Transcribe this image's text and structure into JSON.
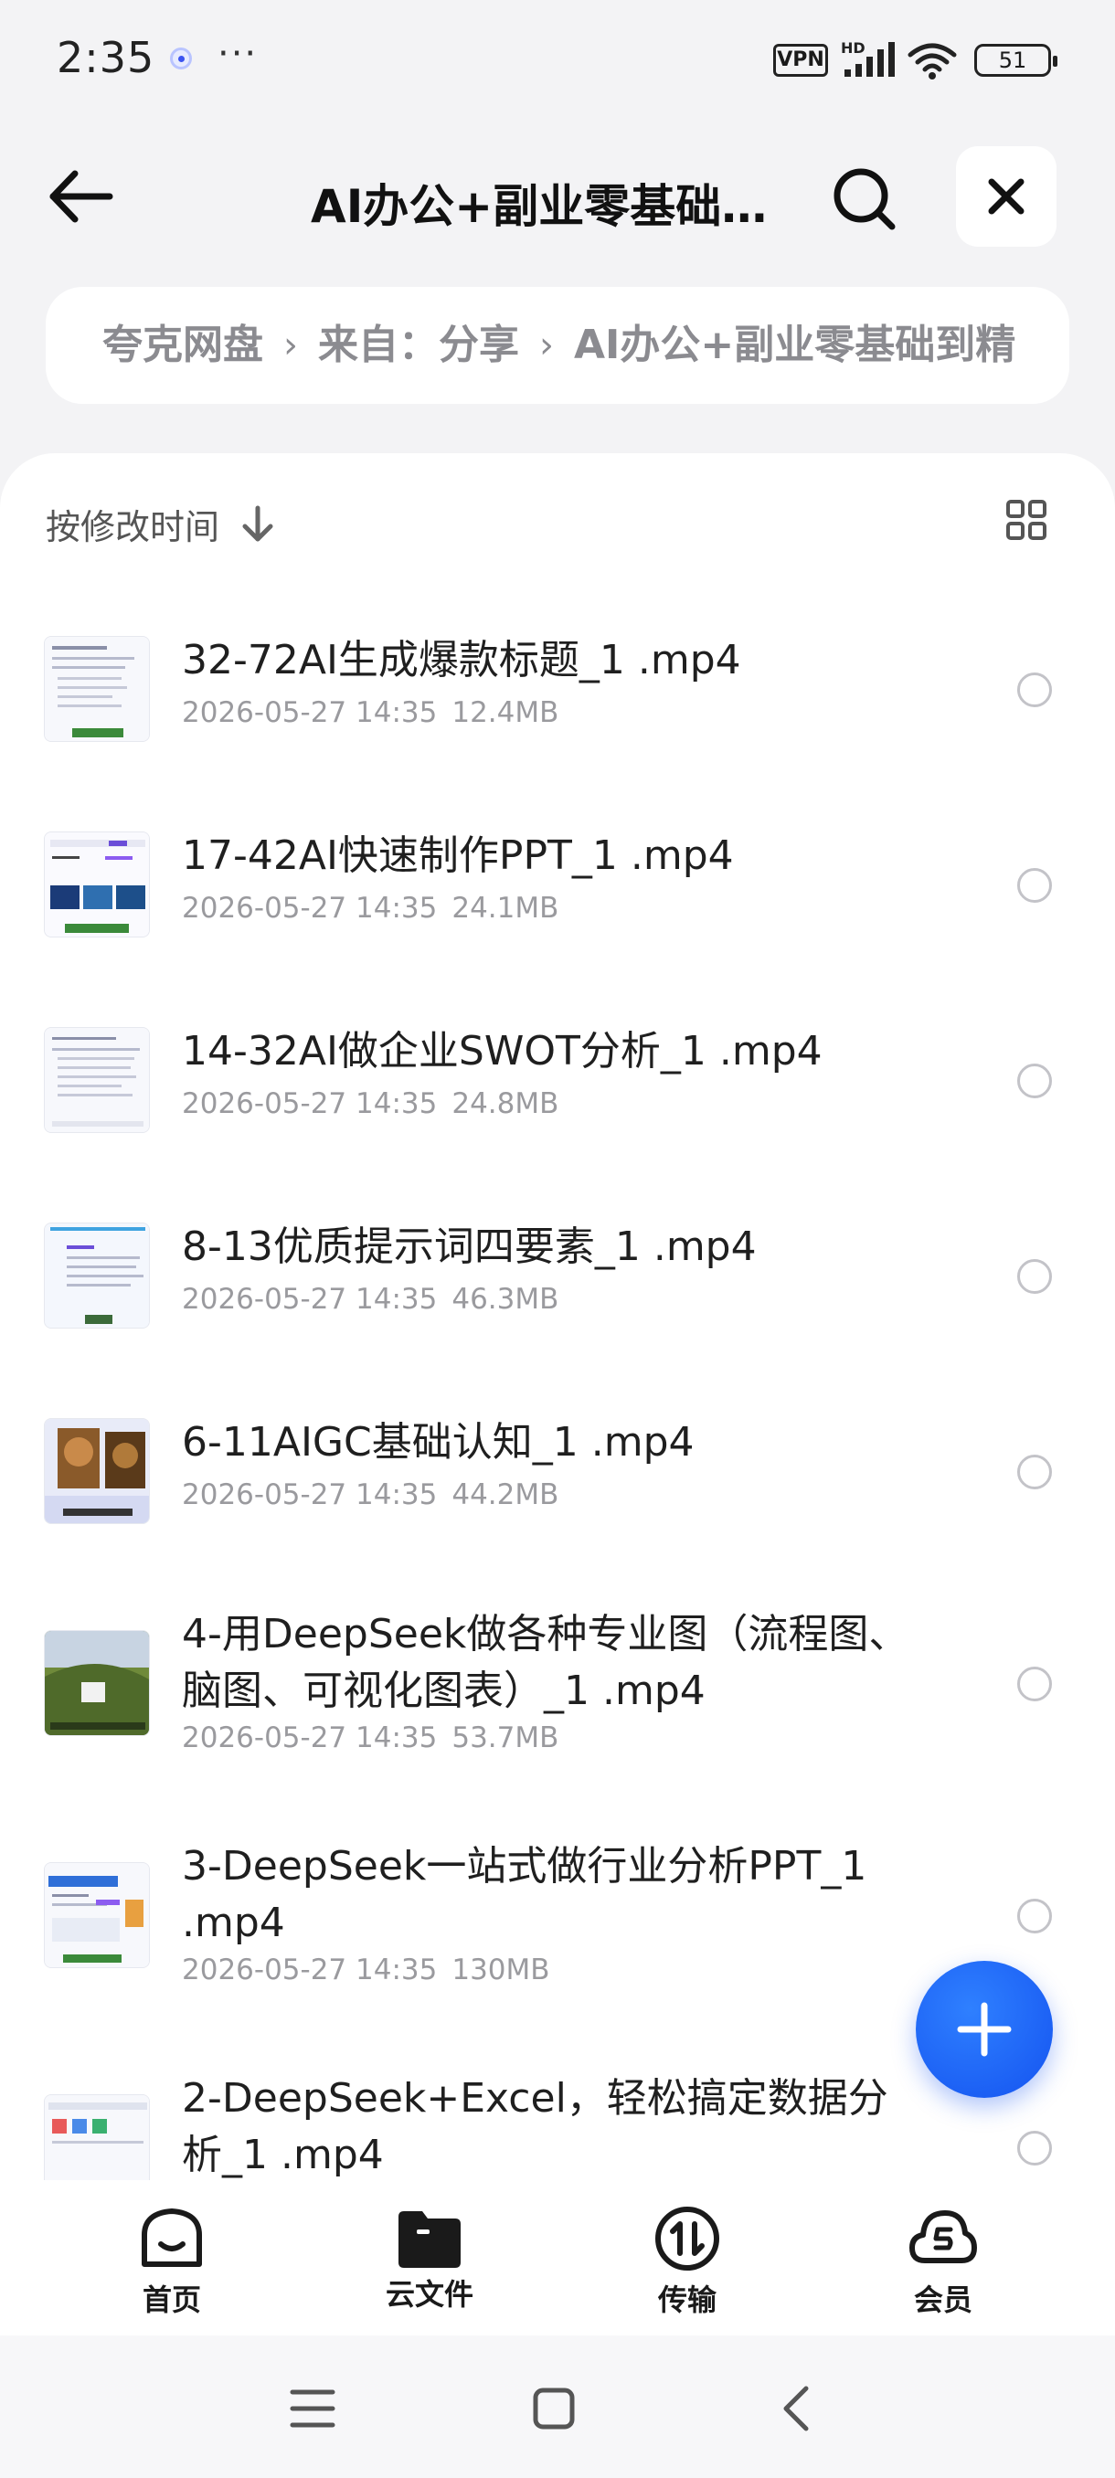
{
  "status_bar": {
    "time": "2:35",
    "more": "···",
    "vpn": "VPN",
    "battery": "51"
  },
  "header": {
    "title": "AI办公+副业零基础..."
  },
  "breadcrumb": [
    "夸克网盘",
    "来自：分享",
    "AI办公+副业零基础到精"
  ],
  "toolbar": {
    "sort_label": "按修改时间"
  },
  "files": [
    {
      "name": "32-72AI生成爆款标题_1 .mp4",
      "date": "2026-05-27 14:35",
      "size": "12.4MB",
      "thumb": "doc"
    },
    {
      "name": "17-42AI快速制作PPT_1 .mp4",
      "date": "2026-05-27 14:35",
      "size": "24.1MB",
      "thumb": "slides"
    },
    {
      "name": "14-32AI做企业SWOT分析_1 .mp4",
      "date": "2026-05-27 14:35",
      "size": "24.8MB",
      "thumb": "doc"
    },
    {
      "name": "8-13优质提示词四要素_1 .mp4",
      "date": "2026-05-27 14:35",
      "size": "46.3MB",
      "thumb": "doc"
    },
    {
      "name": "6-11AIGC基础认知_1 .mp4",
      "date": "2026-05-27 14:35",
      "size": "44.2MB",
      "thumb": "portrait"
    },
    {
      "name": "4-用DeepSeek做各种专业图（流程图、脑图、可视化图表）_1 .mp4",
      "date": "2026-05-27 14:35",
      "size": "53.7MB",
      "thumb": "landscape"
    },
    {
      "name": "3-DeepSeek一站式做行业分析PPT_1 .mp4",
      "date": "2026-05-27 14:35",
      "size": "130MB",
      "thumb": "slides"
    },
    {
      "name": "2-DeepSeek+Excel，轻松搞定数据分析_1 .mp4",
      "date": "",
      "size": "",
      "thumb": "doc"
    }
  ],
  "bottom_nav": [
    {
      "label": "首页",
      "icon": "home-icon"
    },
    {
      "label": "云文件",
      "icon": "folder-icon"
    },
    {
      "label": "传输",
      "icon": "transfer-icon"
    },
    {
      "label": "会员",
      "icon": "member-icon"
    }
  ],
  "colors": {
    "accent": "#1a5ff5",
    "background": "#f3f3f5",
    "meta_text": "#9a9a9e"
  }
}
